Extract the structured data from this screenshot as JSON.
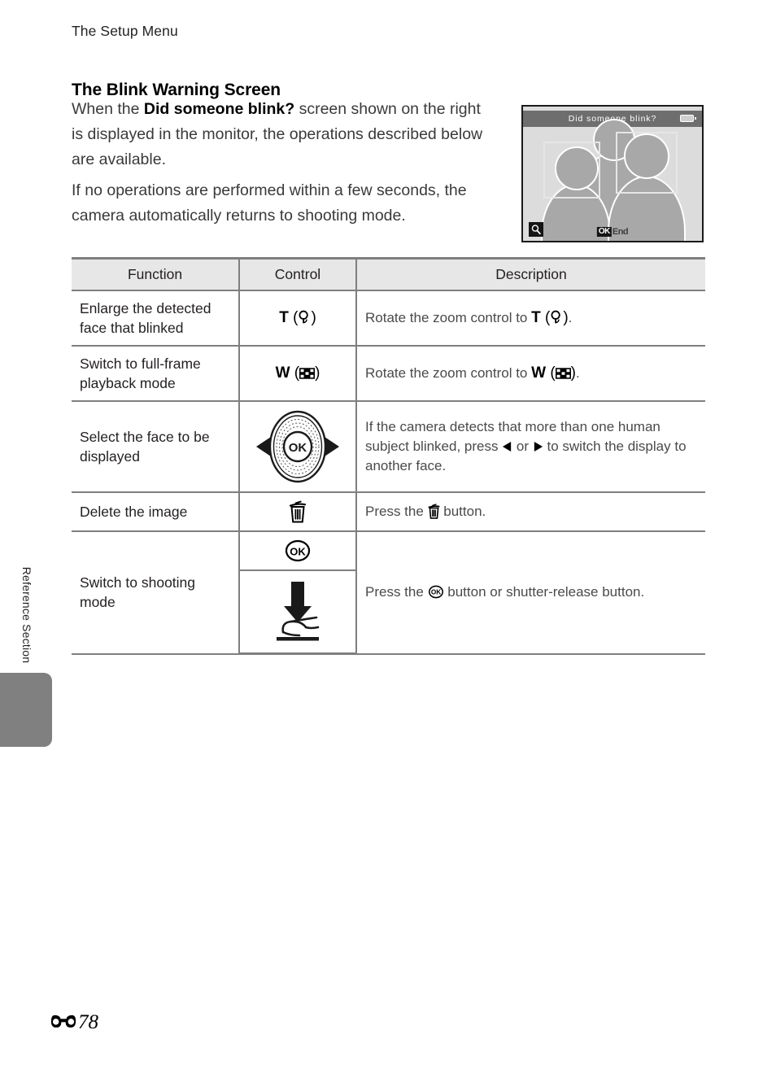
{
  "running_head": "The Setup Menu",
  "side_tab": {
    "label": "Reference Section"
  },
  "section": {
    "heading": "The Blink Warning Screen",
    "paragraph1_pre": "When the ",
    "paragraph1_bold": "Did someone blink?",
    "paragraph1_post": " screen shown on the right is displayed in the monitor, the operations described below are available.",
    "paragraph2": "If no operations are performed within a few seconds, the camera automatically returns to shooting mode."
  },
  "monitor": {
    "title": "Did someone blink?",
    "battery_icon": "battery-icon",
    "magnifier_icon": "magnifier-icon",
    "ok_chip": "OK",
    "end_label": "End"
  },
  "table": {
    "headers": {
      "function": "Function",
      "control": "Control",
      "description": "Description"
    },
    "rows": [
      {
        "function": "Enlarge the detected face that blinked",
        "control_letter": "T",
        "control_icon": "magnifier-icon",
        "desc_pre": "Rotate the zoom control to ",
        "desc_letter": "T",
        "desc_icon": "magnifier-icon",
        "desc_post": "."
      },
      {
        "function": "Switch to full-frame playback mode",
        "control_letter": "W",
        "control_icon": "thumbnail-grid-icon",
        "desc_pre": "Rotate the zoom control to ",
        "desc_letter": "W",
        "desc_icon": "thumbnail-grid-icon",
        "desc_post": "."
      },
      {
        "function": "Select the face to be displayed",
        "control_icon": "multi-selector-dial-icon",
        "desc_pre": "If the camera detects that more than one human subject blinked, press ",
        "desc_mid": " or ",
        "desc_post": " to switch the display to another face.",
        "desc_icon_left": "triangle-left-icon",
        "desc_icon_right": "triangle-right-icon"
      },
      {
        "function": "Delete the image",
        "control_icon": "trash-icon",
        "desc_pre": "Press the ",
        "desc_icon": "trash-icon",
        "desc_post": " button."
      },
      {
        "function": "Switch to shooting mode",
        "control_icon_top": "ok-button-icon",
        "control_icon_bottom": "shutter-press-icon",
        "desc_pre": "Press the ",
        "desc_icon": "ok-button-icon",
        "desc_post": " button or shutter-release button."
      }
    ]
  },
  "footer": {
    "section_mark_icon": "reference-section-mark-icon",
    "page_number": "78"
  },
  "colors": {
    "rule": "#7f7f7f",
    "header_fill": "#e7e7e7",
    "tab_gray": "#808080",
    "monitor_bar": "#6e6e6e"
  }
}
